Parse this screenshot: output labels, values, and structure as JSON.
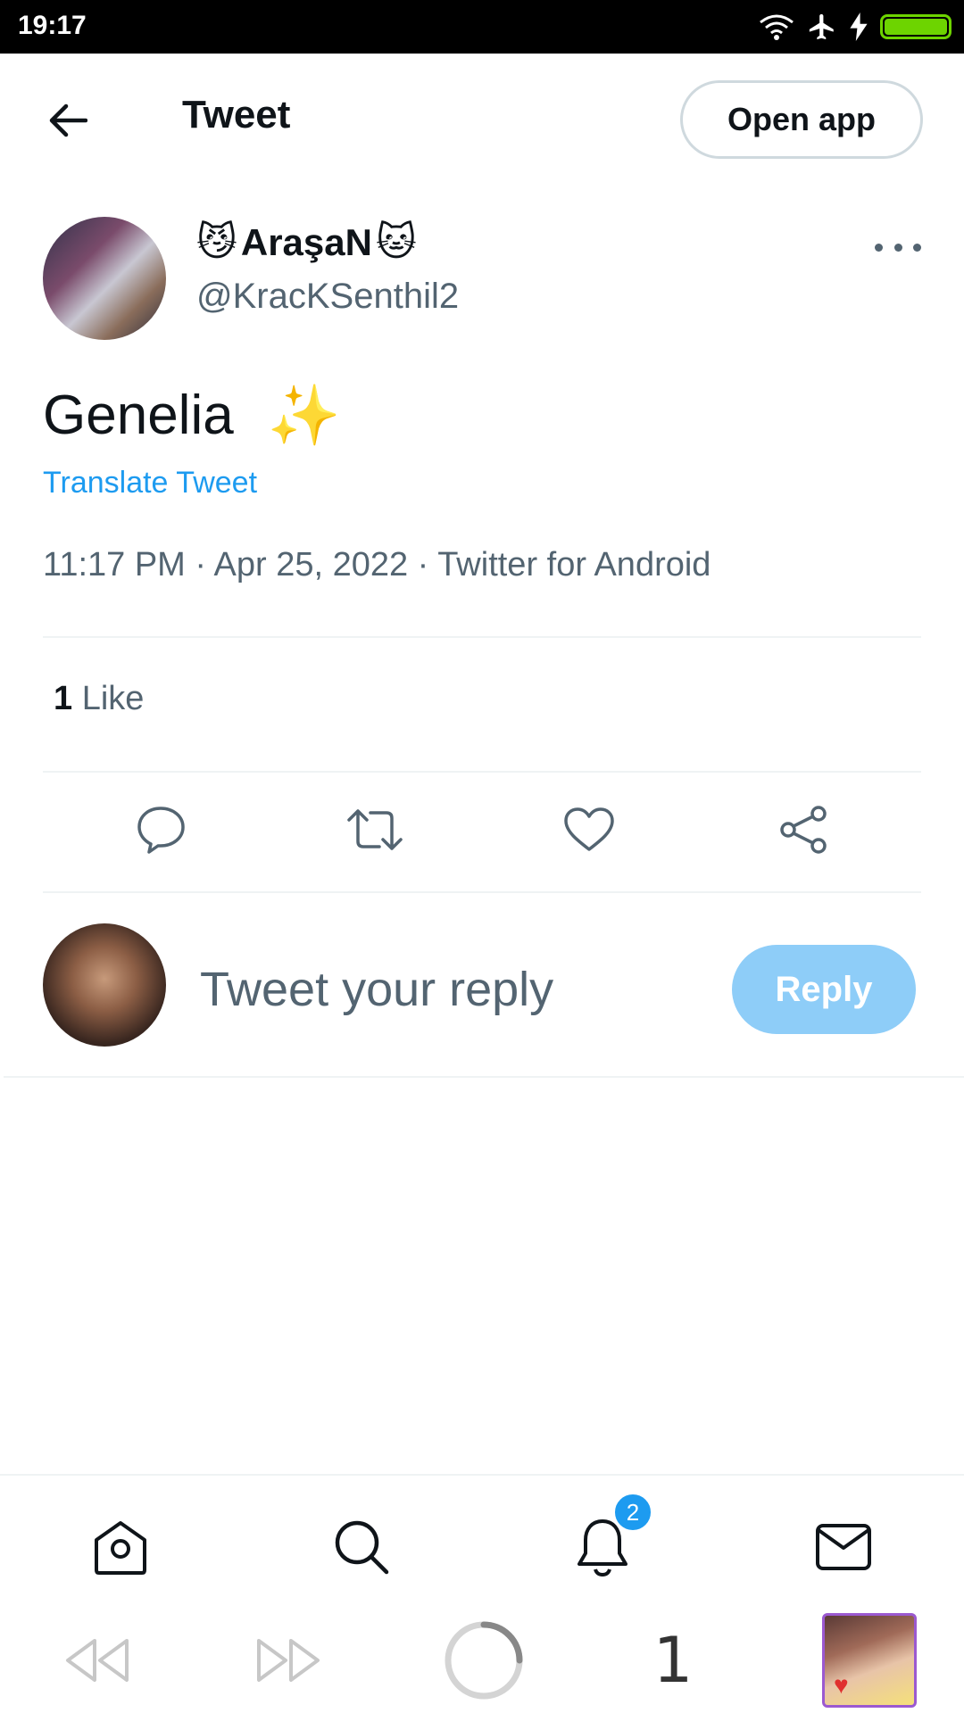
{
  "status_bar": {
    "time": "19:17",
    "icons": [
      "wifi-icon",
      "airplane-mode-icon",
      "charging-icon",
      "battery-icon"
    ],
    "battery_color": "#6dd400"
  },
  "header": {
    "back_icon": "arrow-left-icon",
    "title": "Tweet",
    "open_app_label": "Open app"
  },
  "tweet": {
    "author": {
      "name_prefix_emoji": "😼",
      "name": "AraşaN",
      "name_suffix_emoji": "🐱",
      "handle": "@KracKSenthil2"
    },
    "text": "Genelia",
    "text_emoji": "✨",
    "translate_label": "Translate Tweet",
    "timestamp": "11:17 PM · Apr 25, 2022 · Twitter for Android",
    "likes_count": "1",
    "likes_label": "Like",
    "actions": [
      "reply-icon",
      "retweet-icon",
      "like-icon",
      "share-icon"
    ]
  },
  "reply": {
    "placeholder": "Tweet your reply",
    "button_label": "Reply",
    "button_color": "#8ecdf8"
  },
  "bottom_nav": {
    "items": [
      "home-icon",
      "search-icon",
      "notifications-icon",
      "messages-icon"
    ],
    "notification_badge": "2"
  },
  "system_nav": {
    "tab_count": "1"
  },
  "colors": {
    "accent": "#1d9bf0",
    "text_primary": "#0f1419",
    "text_secondary": "#536471",
    "divider": "#eff3f4"
  }
}
